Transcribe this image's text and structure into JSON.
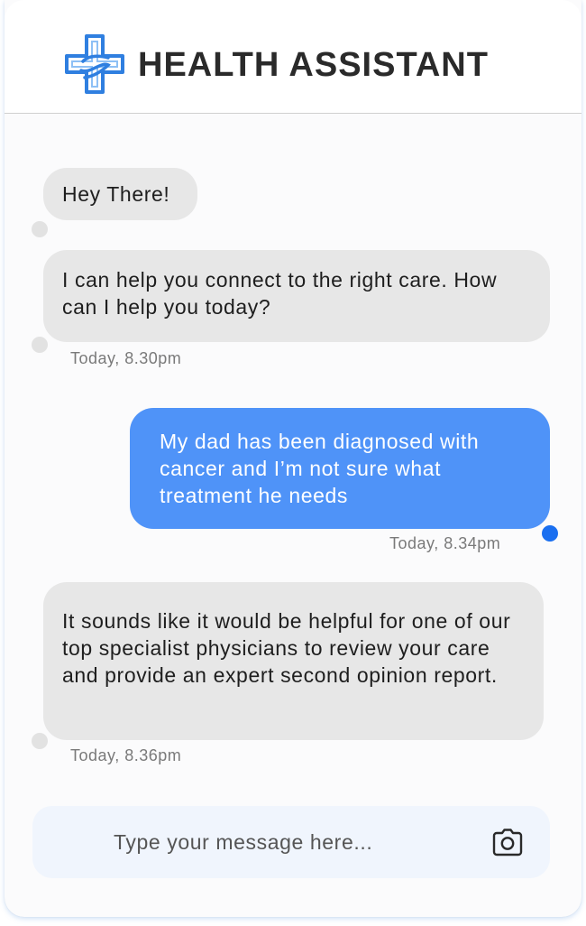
{
  "header": {
    "title": "HEALTH ASSISTANT",
    "logo_icon": "medical-cross-icon",
    "logo_color": "#2f7fe0"
  },
  "messages": [
    {
      "sender": "bot",
      "text": "Hey There!"
    },
    {
      "sender": "bot",
      "text": "I can help you connect to the right care. How can I help you today?",
      "time": "Today, 8.30pm"
    },
    {
      "sender": "user",
      "text": "My dad has been diagnosed with cancer and I’m not sure what treatment he needs",
      "time": "Today, 8.34pm"
    },
    {
      "sender": "bot",
      "text": "It sounds like it would be helpful for one of our top specialist physicians to review your care and provide an expert second opinion report.",
      "time": "Today, 8.36pm"
    }
  ],
  "composer": {
    "placeholder": "Type your message here...",
    "camera_icon": "camera-icon"
  },
  "colors": {
    "user_bubble": "#4f93f8",
    "bot_bubble": "#e7e7e7",
    "user_dot": "#1a6ff0",
    "input_bg": "#f0f5fd"
  }
}
